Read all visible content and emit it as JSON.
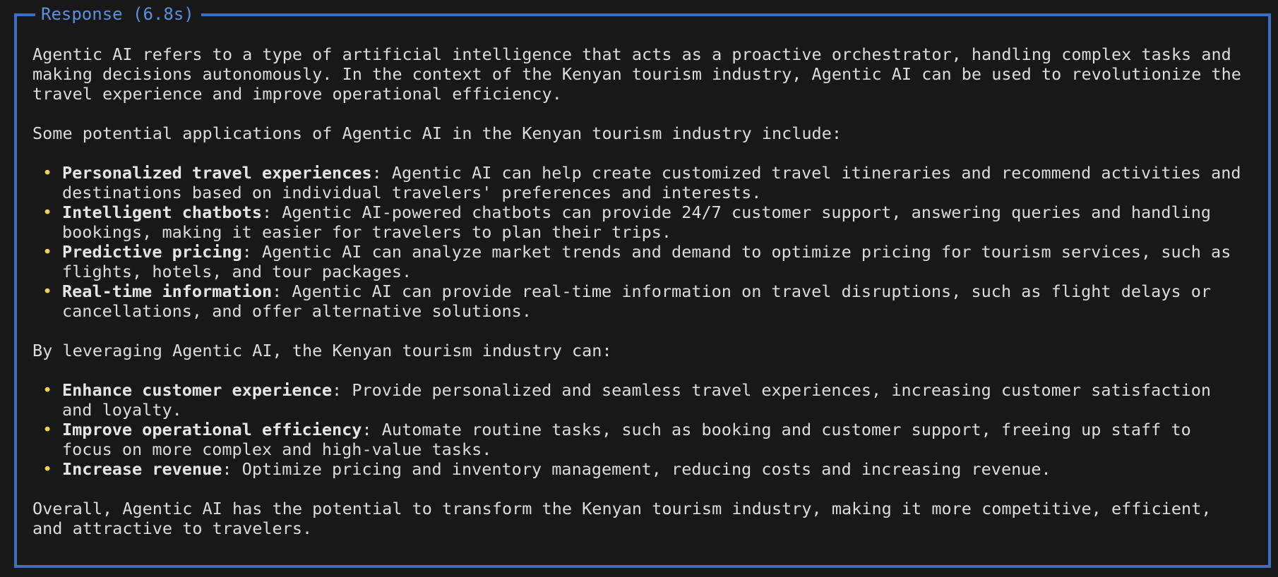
{
  "panel": {
    "title": "Response (6.8s)",
    "accent_color": "#3a6fc4"
  },
  "response": {
    "intro": "Agentic AI refers to a type of artificial intelligence that acts as a proactive orchestrator, handling complex tasks and making decisions autonomously. In the context of the Kenyan tourism industry, Agentic AI can be used to revolutionize the travel experience and improve operational efficiency.",
    "applications_lead": "Some potential applications of Agentic AI in the Kenyan tourism industry include:",
    "applications": [
      {
        "bullet": "•",
        "term": "Personalized travel experiences",
        "sep": ":",
        "text": " Agentic AI can help create customized travel itineraries and recommend activities and destinations based on individual travelers' preferences and interests."
      },
      {
        "bullet": "•",
        "term": "Intelligent chatbots",
        "sep": ":",
        "text": " Agentic AI-powered chatbots can provide 24/7 customer support, answering queries and handling bookings, making it easier for travelers to plan their trips."
      },
      {
        "bullet": "•",
        "term": "Predictive pricing",
        "sep": ":",
        "text": " Agentic AI can analyze market trends and demand to optimize pricing for tourism services, such as flights, hotels, and tour packages."
      },
      {
        "bullet": "•",
        "term": "Real-time information",
        "sep": ":",
        "text": " Agentic AI can provide real-time information on travel disruptions, such as flight delays or cancellations, and offer alternative solutions."
      }
    ],
    "benefits_lead": "By leveraging Agentic AI, the Kenyan tourism industry can:",
    "benefits": [
      {
        "bullet": "•",
        "term": "Enhance customer experience",
        "sep": ":",
        "text": " Provide personalized and seamless travel experiences, increasing customer satisfaction and loyalty."
      },
      {
        "bullet": "•",
        "term": "Improve operational efficiency",
        "sep": ":",
        "text": " Automate routine tasks, such as booking and customer support, freeing up staff to focus on more complex and high-value tasks."
      },
      {
        "bullet": "•",
        "term": "Increase revenue",
        "sep": ":",
        "text": " Optimize pricing and inventory management, reducing costs and increasing revenue."
      }
    ],
    "conclusion": "Overall, Agentic AI has the potential to transform the Kenyan tourism industry, making it more competitive, efficient, and attractive to travelers."
  }
}
